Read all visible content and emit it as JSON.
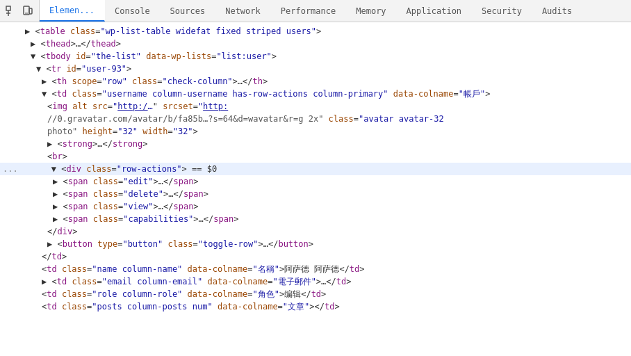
{
  "tabs": [
    {
      "id": "elements",
      "label": "Elemen...",
      "active": true
    },
    {
      "id": "console",
      "label": "Console",
      "active": false
    },
    {
      "id": "sources",
      "label": "Sources",
      "active": false
    },
    {
      "id": "network",
      "label": "Network",
      "active": false
    },
    {
      "id": "performance",
      "label": "Performance",
      "active": false
    },
    {
      "id": "memory",
      "label": "Memory",
      "active": false
    },
    {
      "id": "application",
      "label": "Application",
      "active": false
    },
    {
      "id": "security",
      "label": "Security",
      "active": false
    },
    {
      "id": "audits",
      "label": "Audits",
      "active": false
    }
  ],
  "dom_lines": [
    {
      "id": 1,
      "indent": 12,
      "triangle": "collapsed",
      "html": "▶ &lt;<span class='tag'>table</span> <span class='attr-name'>class</span>=<span class='attr-value'>\"wp-list-table widefat fixed striped users\"</span>&gt;"
    },
    {
      "id": 2,
      "indent": 20,
      "triangle": "collapsed",
      "html": "▶ &lt;<span class='tag'>thead</span>&gt;…&lt;/<span class='tag'>thead</span>&gt;"
    },
    {
      "id": 3,
      "indent": 20,
      "triangle": "expanded",
      "html": "▼ &lt;<span class='tag'>tbody</span> <span class='attr-name'>id</span>=<span class='attr-value'>\"the-list\"</span> <span class='attr-name'>data-wp-lists</span>=<span class='attr-value'>\"list:user\"</span>&gt;"
    },
    {
      "id": 4,
      "indent": 28,
      "triangle": "expanded",
      "html": "▼ &lt;<span class='tag'>tr</span> <span class='attr-name'>id</span>=<span class='attr-value'>\"user-93\"</span>&gt;"
    },
    {
      "id": 5,
      "indent": 36,
      "triangle": "collapsed",
      "html": "▶ &lt;<span class='tag'>th</span> <span class='attr-name'>scope</span>=<span class='attr-value'>\"row\"</span> <span class='attr-name'>class</span>=<span class='attr-value'>\"check-column\"</span>&gt;…&lt;/<span class='tag'>th</span>&gt;"
    },
    {
      "id": 6,
      "indent": 36,
      "triangle": "expanded",
      "html": "▼ &lt;<span class='tag'>td</span> <span class='attr-name'>class</span>=<span class='attr-value'>\"username column-username has-row-actions column-primary\"</span> <span class='attr-name'>data-colname</span>=<span class='attr-value'>\"帳戶\"</span>&gt;"
    },
    {
      "id": 7,
      "indent": 44,
      "triangle": "leaf",
      "html": "&lt;<span class='tag'>img</span> <span class='attr-name'>alt</span> <span class='attr-name'>src</span>=<span class='attr-value'>\"<a class='url-link'>http:/</a></span><span class='attr-value'>…</span>\" <span class='attr-name'>srcset</span>=<span class='attr-value'>\"<a class='url-link'>http:</a></span>"
    },
    {
      "id": 8,
      "indent": 44,
      "triangle": "leaf",
      "html": "<span style='color:#555'>//0.gravatar.com/avatar/b/fa85b…?s=64&d=wavatar&r=g 2x\"</span> <span class='attr-name'>class</span>=<span class='attr-value'>\"avatar avatar-32</span>"
    },
    {
      "id": 9,
      "indent": 44,
      "triangle": "leaf",
      "html": "<span style='color:#555'>photo\"</span> <span class='attr-name'>height</span>=<span class='attr-value'>\"32\"</span> <span class='attr-name'>width</span>=<span class='attr-value'>\"32\"</span>&gt;"
    },
    {
      "id": 10,
      "indent": 44,
      "triangle": "collapsed",
      "html": "▶ &lt;<span class='tag'>strong</span>&gt;…&lt;/<span class='tag'>strong</span>&gt;"
    },
    {
      "id": 11,
      "indent": 44,
      "triangle": "leaf",
      "html": "&lt;<span class='tag'>br</span>&gt;"
    },
    {
      "id": 12,
      "indent": 44,
      "triangle": "expanded",
      "html": "▼ &lt;<span class='tag'>div</span> <span class='attr-name'>class</span>=<span class='attr-value'>\"row-actions\"</span>&gt; == $0",
      "highlighted": true,
      "has_dots": true
    },
    {
      "id": 13,
      "indent": 52,
      "triangle": "collapsed",
      "html": "▶ &lt;<span class='tag'>span</span> <span class='attr-name'>class</span>=<span class='attr-value'>\"edit\"</span>&gt;…&lt;/<span class='tag'>span</span>&gt;"
    },
    {
      "id": 14,
      "indent": 52,
      "triangle": "collapsed",
      "html": "▶ &lt;<span class='tag'>span</span> <span class='attr-name'>class</span>=<span class='attr-value'>\"delete\"</span>&gt;…&lt;/<span class='tag'>span</span>&gt;"
    },
    {
      "id": 15,
      "indent": 52,
      "triangle": "collapsed",
      "html": "▶ &lt;<span class='tag'>span</span> <span class='attr-name'>class</span>=<span class='attr-value'>\"view\"</span>&gt;…&lt;/<span class='tag'>span</span>&gt;"
    },
    {
      "id": 16,
      "indent": 52,
      "triangle": "collapsed",
      "html": "▶ &lt;<span class='tag'>span</span> <span class='attr-name'>class</span>=<span class='attr-value'>\"capabilities\"</span>&gt;…&lt;/<span class='tag'>span</span>&gt;",
      "red_box": true
    },
    {
      "id": 17,
      "indent": 44,
      "triangle": "leaf",
      "html": "&lt;/<span class='tag'>div</span>&gt;"
    },
    {
      "id": 18,
      "indent": 44,
      "triangle": "collapsed",
      "html": "▶ &lt;<span class='tag'>button</span> <span class='attr-name'>type</span>=<span class='attr-value'>\"button\"</span> <span class='attr-name'>class</span>=<span class='attr-value'>\"toggle-row\"</span>&gt;…&lt;/<span class='tag'>button</span>&gt;"
    },
    {
      "id": 19,
      "indent": 36,
      "triangle": "leaf",
      "html": "&lt;/<span class='tag'>td</span>&gt;"
    },
    {
      "id": 20,
      "indent": 36,
      "triangle": "leaf",
      "html": "&lt;<span class='tag'>td</span> <span class='attr-name'>class</span>=<span class='attr-value'>\"name column-name\"</span> <span class='attr-name'>data-colname</span>=<span class='attr-value'>\"名稱\"</span>&gt;阿萨德 阿萨德&lt;/<span class='tag'>td</span>&gt;"
    },
    {
      "id": 21,
      "indent": 36,
      "triangle": "collapsed",
      "html": "▶ &lt;<span class='tag'>td</span> <span class='attr-name'>class</span>=<span class='attr-value'>\"email column-email\"</span> <span class='attr-name'>data-colname</span>=<span class='attr-value'>\"電子郵件\"</span>&gt;…&lt;/<span class='tag'>td</span>&gt;"
    },
    {
      "id": 22,
      "indent": 36,
      "triangle": "leaf",
      "html": "&lt;<span class='tag'>td</span> <span class='attr-name'>class</span>=<span class='attr-value'>\"role column-role\"</span> <span class='attr-name'>data-colname</span>=<span class='attr-value'>\"角色\"</span>&gt;编辑&lt;/<span class='tag'>td</span>&gt;"
    },
    {
      "id": 23,
      "indent": 36,
      "triangle": "leaf",
      "html": "&lt;<span class='tag'>td</span> <span class='attr-name'>class</span>=<span class='attr-value'>\"posts column-posts num\"</span> <span class='attr-name'>data-colname</span>=<span class='attr-value'>\"文章\"</span>&gt;&lt;/<span class='tag'>td</span>&gt;"
    }
  ]
}
